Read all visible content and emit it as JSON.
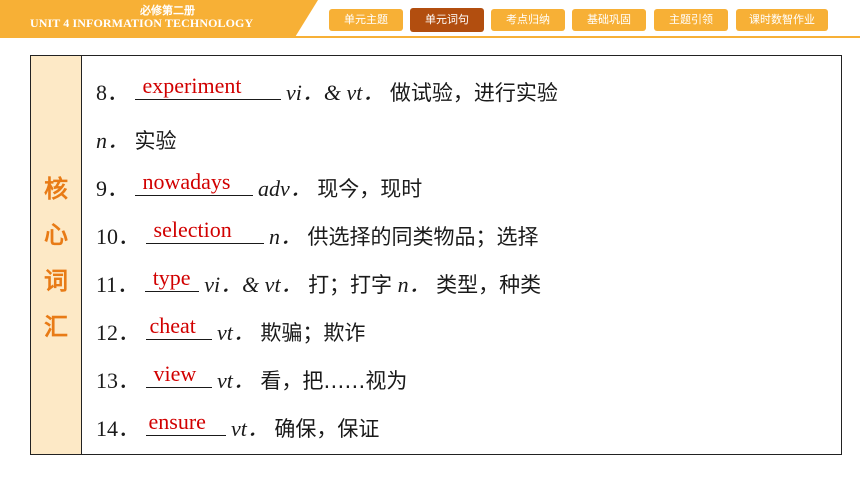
{
  "header": {
    "book": "必修第二册",
    "unit": "UNIT 4    INFORMATION TECHNOLOGY",
    "tabs": [
      {
        "label": "单元主题",
        "active": false
      },
      {
        "label": "单元词句",
        "active": true
      },
      {
        "label": "考点归纳",
        "active": false
      },
      {
        "label": "基础巩固",
        "active": false
      },
      {
        "label": "主题引领",
        "active": false
      },
      {
        "label": "课时数智作业",
        "active": false
      }
    ]
  },
  "sidebar": {
    "chars": [
      "核",
      "心",
      "词",
      "汇"
    ]
  },
  "vocab": [
    {
      "num": "8．",
      "answer": "experiment",
      "pos": "vi．& vt．",
      "meaning": "做试验，进行实验"
    },
    {
      "num": "",
      "answer": "",
      "pos": "n．",
      "meaning": "实验"
    },
    {
      "num": "9．",
      "answer": "nowadays",
      "pos": "adv．",
      "meaning": "现今，现时"
    },
    {
      "num": "10．",
      "answer": "selection",
      "pos": "n．",
      "meaning": "供选择的同类物品；选择"
    },
    {
      "num": "11．",
      "answer": "type",
      "pos": "vi．& vt．",
      "meaning": "打；打字",
      "pos2": "n．",
      "meaning2": "类型，种类"
    },
    {
      "num": "12．",
      "answer": "cheat",
      "pos": "vt．",
      "meaning": "欺骗；欺诈"
    },
    {
      "num": "13．",
      "answer": "view",
      "pos": "vt．",
      "meaning": "看，把……视为"
    },
    {
      "num": "14．",
      "answer": "ensure",
      "pos": "vt．",
      "meaning": "确保，保证"
    }
  ],
  "colors": {
    "accent": "#f7b036",
    "active_tab": "#b24e0f",
    "answer": "#d10000",
    "sidebar_bg": "#fde9c6",
    "sidebar_text": "#e87b16"
  }
}
